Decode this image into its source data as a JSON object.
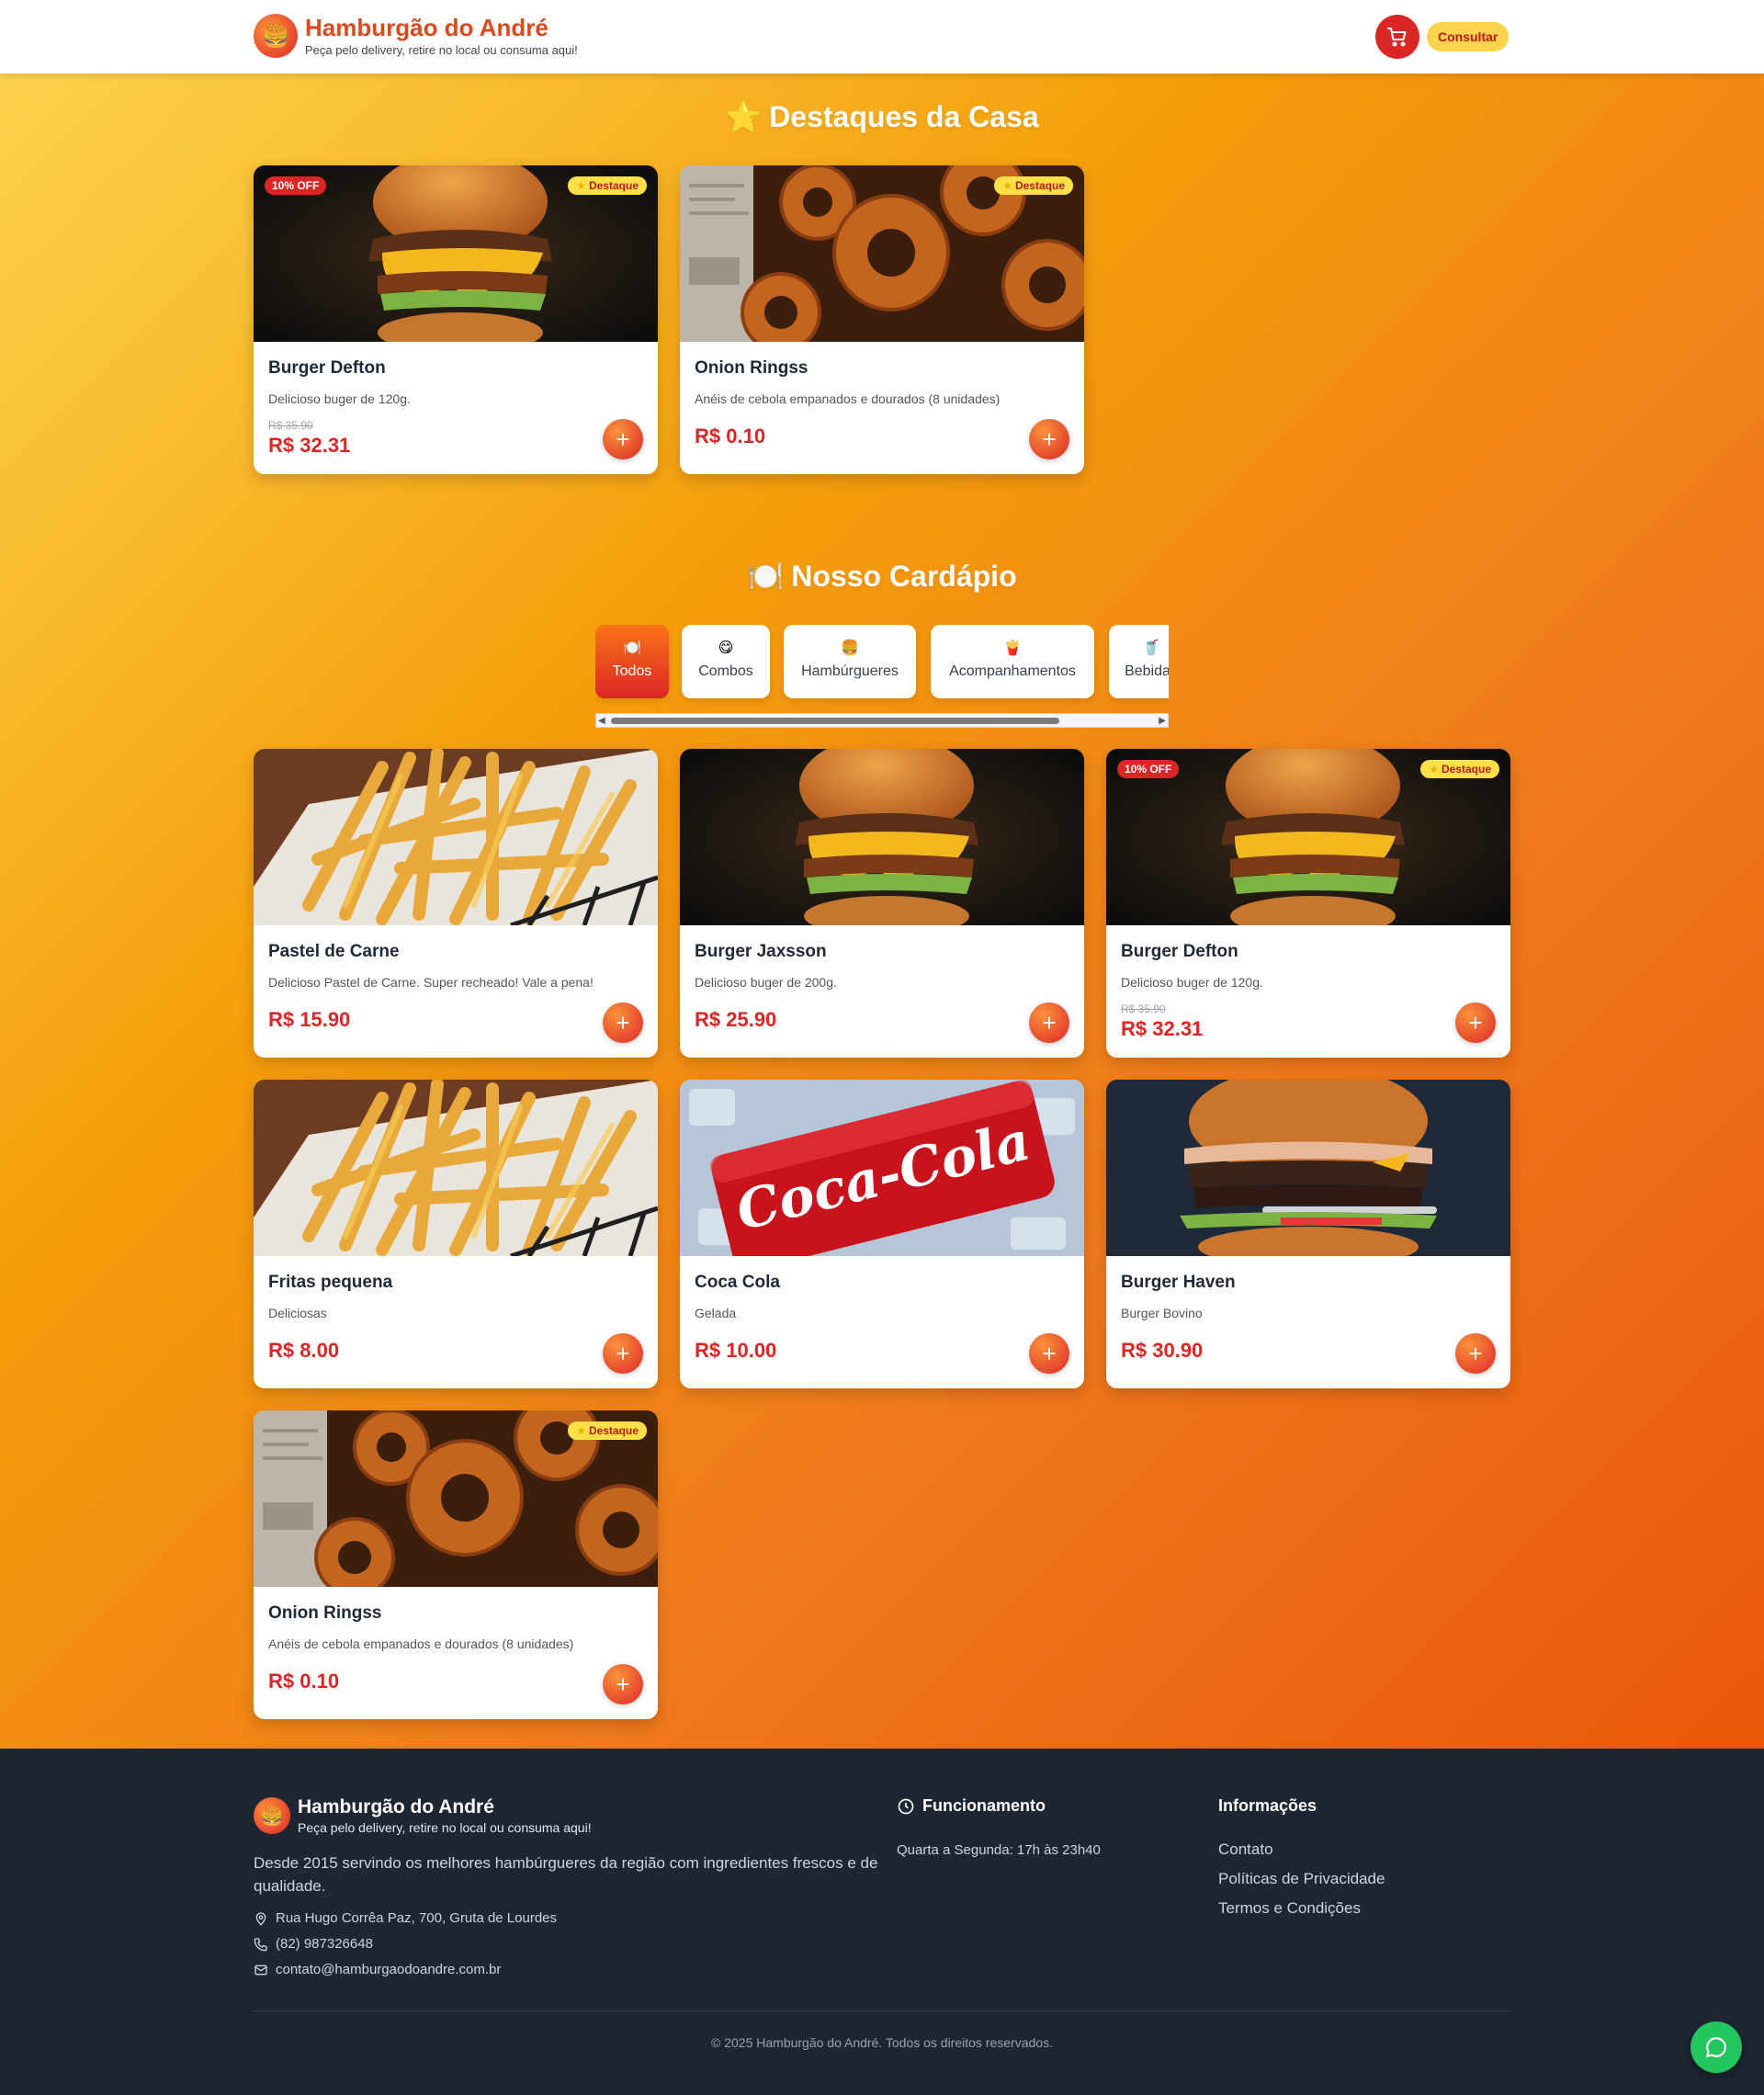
{
  "header": {
    "logo_emoji": "🍔",
    "name": "Hamburgão do André",
    "tagline": "Peça pelo delivery, retire no local ou consuma aqui!",
    "consult_label": "Consultar"
  },
  "featured": {
    "emoji": "⭐",
    "title": "Destaques da Casa",
    "items": [
      {
        "name": "Burger Defton",
        "desc": "Delicioso buger de 120g.",
        "old_price": "R$ 35.90",
        "price": "R$ 32.31",
        "discount": "10% OFF",
        "featured": "Destaque",
        "image": "burger"
      },
      {
        "name": "Onion Ringss",
        "desc": "Anéis de cebola empanados e dourados (8 unidades)",
        "price": "R$ 0.10",
        "featured": "Destaque",
        "image": "onion-rings"
      }
    ]
  },
  "menu": {
    "emoji": "🍽️",
    "title": "Nosso Cardápio",
    "tabs": [
      {
        "icon": "🍽️",
        "label": "Todos"
      },
      {
        "icon": "😋",
        "label": "Combos"
      },
      {
        "icon": "🍔",
        "label": "Hambúrgueres"
      },
      {
        "icon": "🍟",
        "label": "Acompanhamentos"
      },
      {
        "icon": "🥤",
        "label": "Bebidas"
      }
    ],
    "items": [
      {
        "name": "Pastel de Carne",
        "desc": "Delicioso Pastel de Carne. Super recheado! Vale a pena!",
        "price": "R$ 15.90",
        "image": "fries"
      },
      {
        "name": "Burger Jaxsson",
        "desc": "Delicioso buger de 200g.",
        "price": "R$ 25.90",
        "image": "burger"
      },
      {
        "name": "Burger Defton",
        "desc": "Delicioso buger de 120g.",
        "old_price": "R$ 35.90",
        "price": "R$ 32.31",
        "discount": "10% OFF",
        "featured": "Destaque",
        "image": "burger"
      },
      {
        "name": "Fritas pequena",
        "desc": "Deliciosas",
        "price": "R$ 8.00",
        "image": "fries"
      },
      {
        "name": "Coca Cola",
        "desc": "Gelada",
        "price": "R$ 10.00",
        "image": "coca-cola"
      },
      {
        "name": "Burger Haven",
        "desc": "Burger Bovino",
        "price": "R$ 30.90",
        "image": "burger-haven"
      },
      {
        "name": "Onion Ringss",
        "desc": "Anéis de cebola empanados e dourados (8 unidades)",
        "price": "R$ 0.10",
        "featured": "Destaque",
        "image": "onion-rings"
      }
    ]
  },
  "footer": {
    "name": "Hamburgão do André",
    "tagline": "Peça pelo delivery, retire no local ou consuma aqui!",
    "about": "Desde 2015 servindo os melhores hambúrgueres da região com ingredientes frescos e de qualidade.",
    "address": "Rua Hugo Corrêa Paz, 700, Gruta de Lourdes",
    "phone": "(82) 987326648",
    "email": "contato@hamburgaodoandre.com.br",
    "hours_title": "Funcionamento",
    "hours": "Quarta a Segunda: 17h às 23h40",
    "info_title": "Informações",
    "links": [
      "Contato",
      "Políticas de Privacidade",
      "Termos e Condições"
    ],
    "copyright": "© 2025 Hamburgão do André. Todos os direitos reservados."
  },
  "colors": {
    "accent": "#dc2626",
    "brand": "#ea580c",
    "badge_yellow": "#fde047",
    "footer_bg": "#1e2533",
    "chat_green": "#22c55e"
  }
}
